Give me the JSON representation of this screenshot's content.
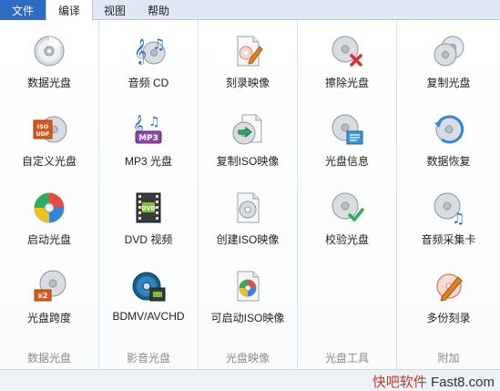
{
  "menu": {
    "file": "文件",
    "edit": "编译",
    "view": "视图",
    "help": "帮助"
  },
  "groups": [
    {
      "title": "数据光盘",
      "items": [
        {
          "label": "数据光盘",
          "icon": "data-disc-icon"
        },
        {
          "label": "自定义光盘",
          "icon": "iso-udf-disc-icon"
        },
        {
          "label": "启动光盘",
          "icon": "boot-disc-icon"
        },
        {
          "label": "光盘跨度",
          "icon": "disc-span-icon"
        }
      ]
    },
    {
      "title": "影音光盘",
      "items": [
        {
          "label": "音频 CD",
          "icon": "audio-cd-icon"
        },
        {
          "label": "MP3 光盘",
          "icon": "mp3-disc-icon"
        },
        {
          "label": "DVD 视频",
          "icon": "dvd-video-icon"
        },
        {
          "label": "BDMV/AVCHD",
          "icon": "bdmv-disc-icon"
        }
      ]
    },
    {
      "title": "光盘映像",
      "items": [
        {
          "label": "刻录映像",
          "icon": "burn-image-icon"
        },
        {
          "label": "复制ISO映像",
          "icon": "copy-iso-icon"
        },
        {
          "label": "创建ISO映像",
          "icon": "create-iso-icon"
        },
        {
          "label": "可启动ISO映像",
          "icon": "bootable-iso-icon"
        }
      ]
    },
    {
      "title": "光盘工具",
      "items": [
        {
          "label": "擦除光盘",
          "icon": "erase-disc-icon"
        },
        {
          "label": "光盘信息",
          "icon": "disc-info-icon"
        },
        {
          "label": "校验光盘",
          "icon": "verify-disc-icon"
        }
      ]
    },
    {
      "title": "附加",
      "items": [
        {
          "label": "复制光盘",
          "icon": "copy-disc-icon"
        },
        {
          "label": "数据恢复",
          "icon": "data-recovery-icon"
        },
        {
          "label": "音频采集卡",
          "icon": "audio-grabber-icon"
        },
        {
          "label": "多份刻录",
          "icon": "multi-burn-icon"
        }
      ]
    }
  ],
  "watermark": {
    "cn": "快吧软件",
    "en": "Fast8.com"
  },
  "colors": {
    "file_tab": "#2b6cc4",
    "menubar": "#dfe9f5",
    "group_title": "#8a8a8a",
    "watermark": "#c0392b"
  }
}
